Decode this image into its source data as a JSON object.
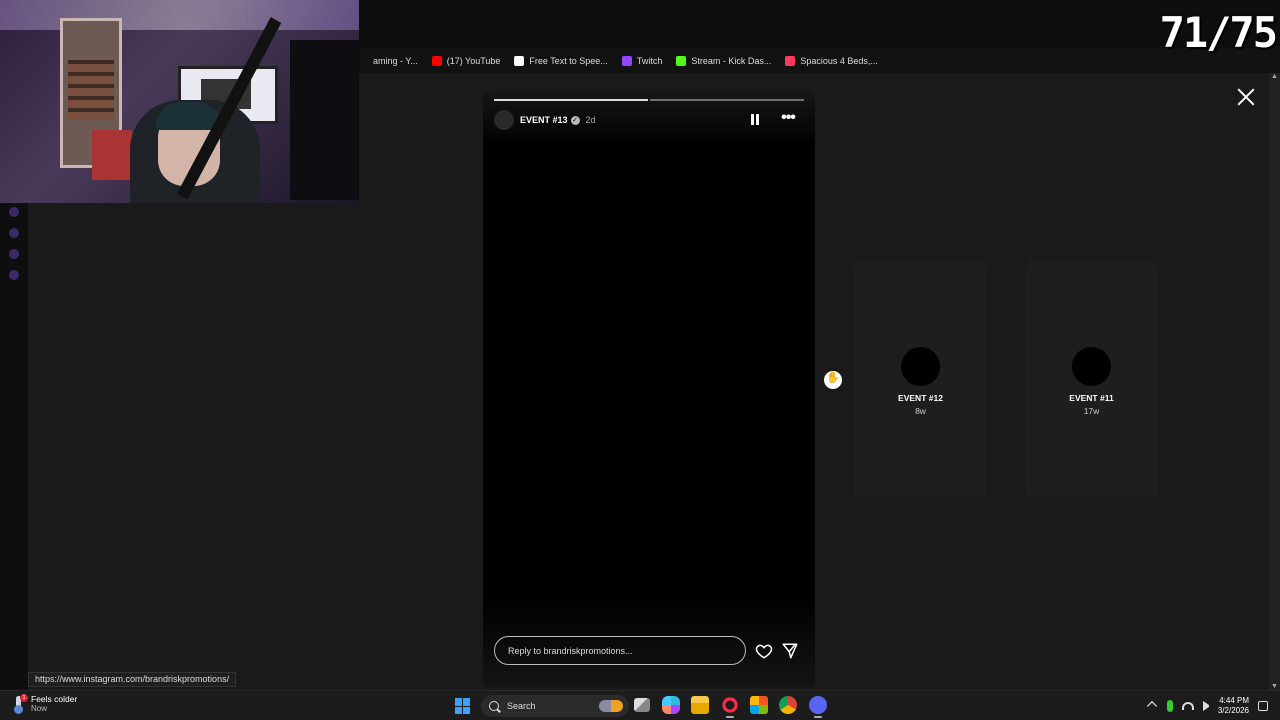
{
  "overlay": {
    "counter": "71/75"
  },
  "bookmarks": [
    {
      "label": "aming - Y...",
      "color": "#111111"
    },
    {
      "label": "(17) YouTube",
      "color": "#ff0000"
    },
    {
      "label": "Free Text to Spee...",
      "color": "#ffffff"
    },
    {
      "label": "Twitch",
      "color": "#9146ff"
    },
    {
      "label": "Stream - Kick Das...",
      "color": "#53fc18"
    },
    {
      "label": "Spacious 4 Beds,...",
      "color": "#ff385c"
    }
  ],
  "story": {
    "username": "EVENT #13",
    "verified_glyph": "✓",
    "age": "2d",
    "more_glyph": "•••",
    "reply_placeholder": "Reply to brandriskpromotions..."
  },
  "previews": [
    {
      "name": "EVENT #12",
      "age": "8w"
    },
    {
      "name": "EVENT #11",
      "age": "17w"
    }
  ],
  "status_url": "https://www.instagram.com/brandriskpromotions/",
  "taskbar": {
    "weather_title": "Feels colder",
    "weather_sub": "Now",
    "weather_badge": "1",
    "search_label": "Search",
    "time": "4:44 PM",
    "date": "3/2/2026",
    "apps": [
      "task-view",
      "copilot",
      "file-explorer",
      "opera-gx",
      "microsoft-store",
      "chrome",
      "discord"
    ]
  },
  "colors": {
    "accent": "#3ea1ff",
    "background": "#1a1a1a",
    "story_bg": "#000000"
  }
}
